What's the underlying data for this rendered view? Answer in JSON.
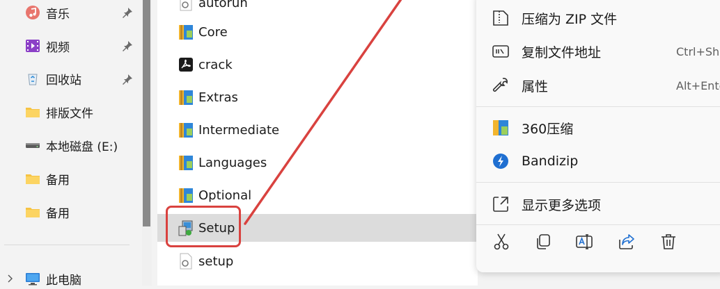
{
  "sidebar": {
    "items": [
      {
        "label": "音乐",
        "icon": "music-icon",
        "pinned": true
      },
      {
        "label": "视频",
        "icon": "video-icon",
        "pinned": true
      },
      {
        "label": "回收站",
        "icon": "recycle-bin-icon",
        "pinned": true
      },
      {
        "label": "排版文件",
        "icon": "folder-icon",
        "pinned": false
      },
      {
        "label": "本地磁盘 (E:)",
        "icon": "drive-icon",
        "pinned": false
      },
      {
        "label": "备用",
        "icon": "folder-icon",
        "pinned": false
      },
      {
        "label": "备用",
        "icon": "folder-icon",
        "pinned": false
      }
    ],
    "this_pc": "此电脑"
  },
  "files": [
    {
      "name": "autorun",
      "icon": "settings-file-icon"
    },
    {
      "name": "Core",
      "icon": "archive-folder-icon"
    },
    {
      "name": "crack",
      "icon": "pdf-icon"
    },
    {
      "name": "Extras",
      "icon": "archive-folder-icon"
    },
    {
      "name": "Intermediate",
      "icon": "archive-folder-icon"
    },
    {
      "name": "Languages",
      "icon": "archive-folder-icon"
    },
    {
      "name": "Optional",
      "icon": "archive-folder-icon"
    },
    {
      "name": "Setup",
      "icon": "setup-exe-icon",
      "selected": true
    },
    {
      "name": "setup",
      "icon": "settings-file-icon"
    }
  ],
  "context_menu": {
    "compress_zip": "压缩为 ZIP 文件",
    "copy_path": "复制文件地址",
    "copy_path_shortcut": "Ctrl+Shi",
    "properties": "属性",
    "properties_shortcut": "Alt+Ente",
    "compress_360": "360压缩",
    "bandizip": "Bandizip",
    "more_options": "显示更多选项",
    "toolbar": [
      "cut-icon",
      "copy-icon",
      "rename-icon",
      "share-icon",
      "delete-icon"
    ]
  },
  "colors": {
    "highlight": "#d9423f",
    "selected_row": "#dcdcdc",
    "accent": "#0a6cd6"
  }
}
